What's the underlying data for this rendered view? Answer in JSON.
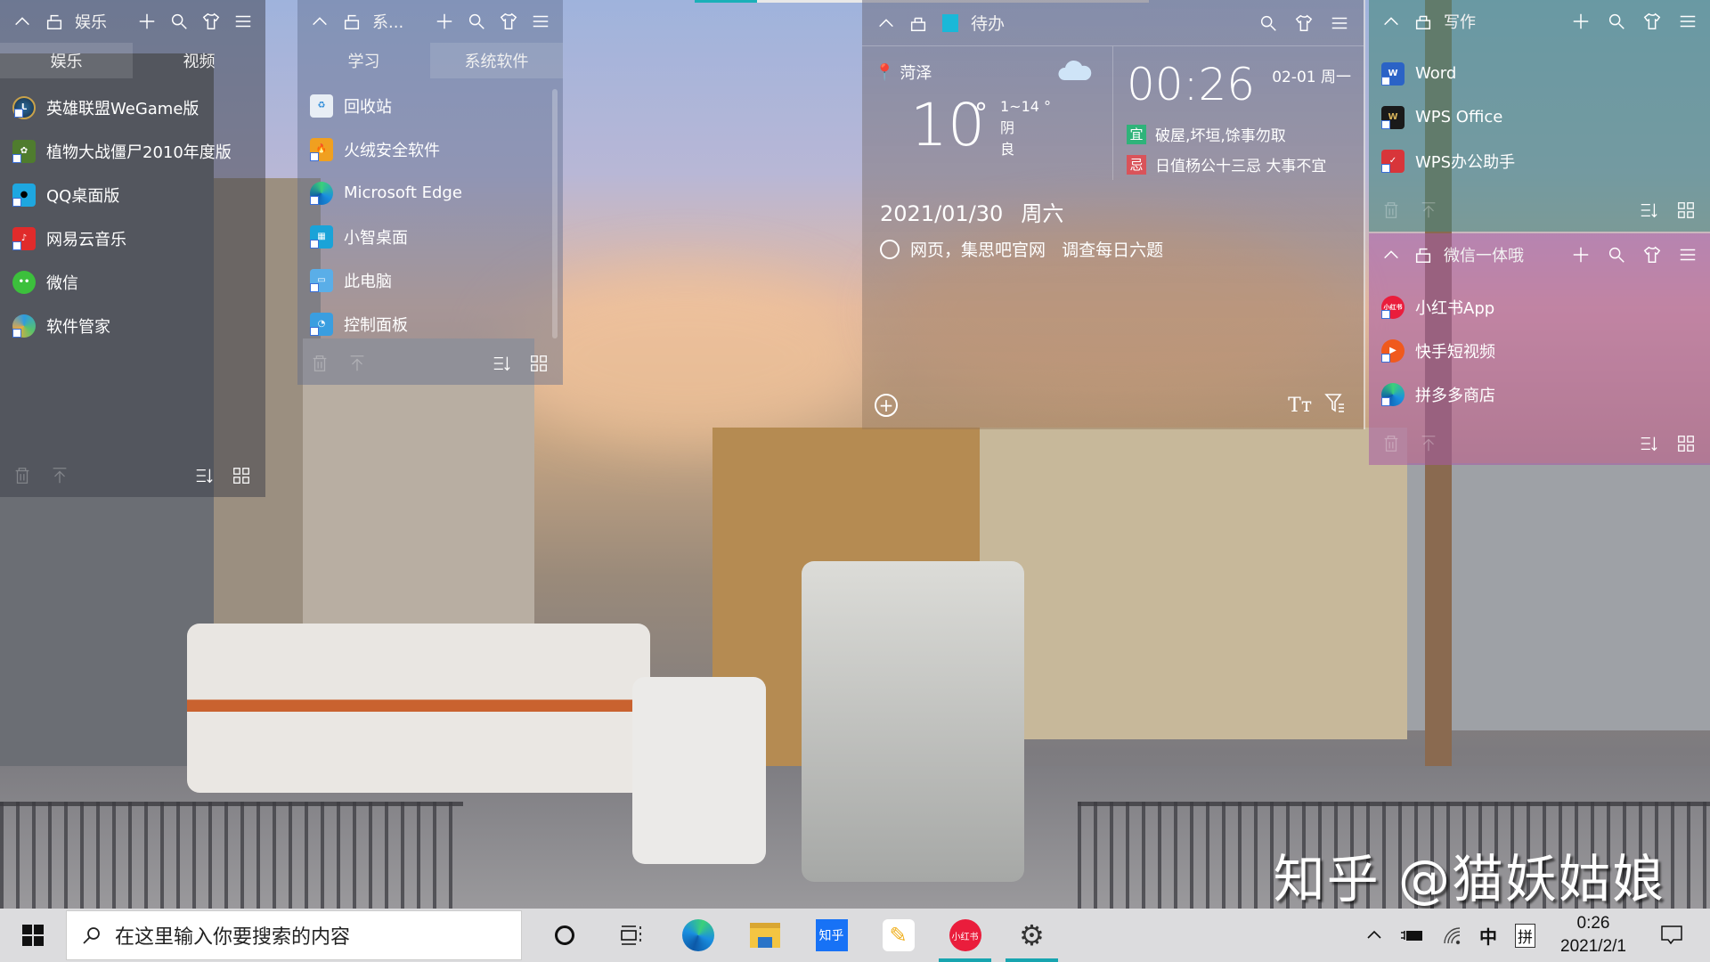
{
  "desktop": {
    "watermark": "知乎 @猫妖姑娘",
    "accent": "#18a5b0"
  },
  "panels": [
    {
      "title": "娱乐",
      "color": "rgba(70,70,80,0.45)",
      "tabs": [
        {
          "label": "娱乐",
          "active": true
        },
        {
          "label": "视频",
          "active": false
        }
      ],
      "items": [
        {
          "label": "英雄联盟WeGame版",
          "icon": "league-of-legends-icon"
        },
        {
          "label": "植物大战僵尸2010年度版",
          "icon": "plants-vs-zombies-icon"
        },
        {
          "label": "QQ桌面版",
          "icon": "qq-icon"
        },
        {
          "label": "网易云音乐",
          "icon": "netease-music-icon"
        },
        {
          "label": "微信",
          "icon": "wechat-icon"
        },
        {
          "label": "软件管家",
          "icon": "software-manager-icon"
        }
      ]
    },
    {
      "title": "系...",
      "color": "rgba(90,100,130,0.45)",
      "tabs": [
        {
          "label": "学习",
          "active": false
        },
        {
          "label": "系统软件",
          "active": true
        }
      ],
      "items": [
        {
          "label": "回收站",
          "icon": "recycle-bin-icon"
        },
        {
          "label": "火绒安全软件",
          "icon": "huorong-icon"
        },
        {
          "label": "Microsoft Edge",
          "icon": "edge-icon"
        },
        {
          "label": "小智桌面",
          "icon": "xiaozhi-desktop-icon"
        },
        {
          "label": "此电脑",
          "icon": "this-pc-icon"
        },
        {
          "label": "控制面板",
          "icon": "control-panel-icon"
        }
      ]
    },
    {
      "title": "写作",
      "color": "rgba(60,130,120,0.55)",
      "items": [
        {
          "label": "Word",
          "icon": "word-icon"
        },
        {
          "label": "WPS Office",
          "icon": "wps-office-icon"
        },
        {
          "label": "WPS办公助手",
          "icon": "wps-assistant-icon"
        }
      ]
    },
    {
      "title": "微信一体哦",
      "color": "rgba(160,80,160,0.5)",
      "items": [
        {
          "label": "小红书App",
          "icon": "xiaohongshu-icon"
        },
        {
          "label": "快手短视频",
          "icon": "kuaishou-icon"
        },
        {
          "label": "拼多多商店",
          "icon": "pinduoduo-icon"
        }
      ]
    }
  ],
  "todo": {
    "title": "待办",
    "weather": {
      "city": "菏泽",
      "temp": "10",
      "deg": "°",
      "range": "1~14 °",
      "condition": "阴",
      "air": "良"
    },
    "clock": {
      "time": "00:26",
      "date": "02-01 周一",
      "good_label": "宜",
      "good": "破屋,坏垣,馀事勿取",
      "bad_label": "忌",
      "bad": "日值杨公十三忌 大事不宜",
      "good_color": "#2fb37a",
      "bad_color": "#d9535a"
    },
    "date": "2021/01/30",
    "weekday": "周六",
    "tasks": [
      {
        "label": "网页，集思吧官网   调查每日六题",
        "done": false
      }
    ]
  },
  "taskbar": {
    "search_placeholder": "在这里输入你要搜索的内容",
    "apps": [
      {
        "name": "cortana",
        "icon": "cortana-icon"
      },
      {
        "name": "task-view",
        "icon": "task-view-icon"
      },
      {
        "name": "edge",
        "icon": "edge-icon"
      },
      {
        "name": "file-explorer",
        "icon": "folder-icon"
      },
      {
        "name": "zhihu",
        "icon": "zhihu-icon",
        "label": "知乎"
      },
      {
        "name": "feather-app",
        "icon": "feather-icon"
      },
      {
        "name": "xiaohongshu",
        "icon": "xiaohongshu-icon",
        "label": "小红书",
        "running": true
      },
      {
        "name": "settings",
        "icon": "gear-icon",
        "running": true
      }
    ],
    "tray": {
      "ime_mode": "中",
      "ime_name": "拼",
      "time": "0:26",
      "date": "2021/2/1"
    }
  }
}
